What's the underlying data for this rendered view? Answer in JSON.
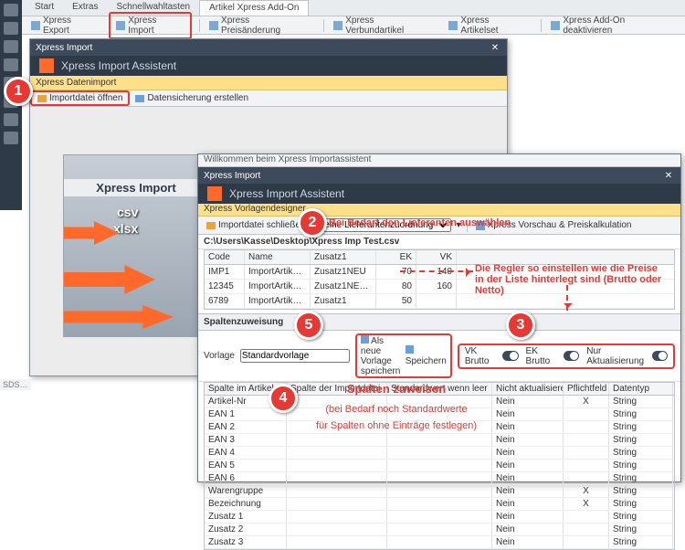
{
  "top_tabs": {
    "start": "Start",
    "extras": "Extras",
    "schnell": "Schnellwahltasten",
    "addon": "Artikel Xpress Add-On"
  },
  "ribbon": {
    "export": "Xpress Export",
    "import": "Xpress Import",
    "preis": "Xpress Preisänderung",
    "verbund": "Xpress Verbundartikel",
    "artikelset": "Xpress Artikelset",
    "deakt": "Xpress Add-On deaktivieren"
  },
  "win1": {
    "title": "Xpress Import",
    "assistent": "Xpress Import Assistent",
    "sub": "Xpress Datenimport",
    "open": "Importdatei öffnen",
    "backup": "Datensicherung erstellen"
  },
  "illus": {
    "title": "Xpress Import",
    "csv": "csv",
    "xlsx": "xlsx"
  },
  "win2": {
    "welcome": "Willkommen beim Xpress Importassistent",
    "title": "Xpress Import",
    "assistent": "Xpress Import Assistent",
    "sub": "Xpress Vorlagendesigner",
    "close_file": "Importdatei schließen",
    "supplier_sel": "Keine Lieferantenzuordnung",
    "preview": "Xpress Vorschau & Preiskalkulation",
    "path": "C:\\Users\\Kasse\\Desktop\\Xpress Imp Test.csv"
  },
  "grid1": {
    "headers": {
      "code": "Code",
      "name": "Name",
      "z1": "Zusatz1",
      "ek": "EK",
      "vk": "VK"
    },
    "rows": [
      {
        "code": "IMP1",
        "name": "ImportArtik…",
        "z1": "Zusatz1NEU",
        "ek": "70",
        "vk": "140"
      },
      {
        "code": "12345",
        "name": "ImportArtik…",
        "z1": "Zusatz1NE…",
        "ek": "80",
        "vk": "160"
      },
      {
        "code": "6789",
        "name": "ImportArtik…",
        "z1": "Zusatz1",
        "ek": "50",
        "vk": ""
      }
    ]
  },
  "spalten": {
    "title": "Spaltenzuweisung",
    "vorlage_lbl": "Vorlage",
    "vorlage_val": "Standardvorlage",
    "save_new": "Als neue Vorlage speichern",
    "save": "Speichern",
    "vk_brutto": "VK Brutto",
    "ek_brutto": "EK Brutto",
    "nur_akt": "Nur Aktualisierung",
    "h1": "Spalte im Artikelstamm",
    "h2": "Spalte der Importdatei",
    "h3": "Standardwert wenn leer",
    "h4": "Nicht aktualisieren",
    "h5": "Pflichtfeld",
    "h6": "Datentyp",
    "rows": [
      {
        "c1": "Artikel-Nr",
        "c4": "Nein",
        "c5": "X",
        "c6": "String"
      },
      {
        "c1": "EAN 1",
        "c4": "Nein",
        "c5": "",
        "c6": "String"
      },
      {
        "c1": "EAN 2",
        "c4": "Nein",
        "c5": "",
        "c6": "String"
      },
      {
        "c1": "EAN 3",
        "c4": "Nein",
        "c5": "",
        "c6": "String"
      },
      {
        "c1": "EAN 4",
        "c4": "Nein",
        "c5": "",
        "c6": "String"
      },
      {
        "c1": "EAN 5",
        "c4": "Nein",
        "c5": "",
        "c6": "String"
      },
      {
        "c1": "EAN 6",
        "c4": "Nein",
        "c5": "",
        "c6": "String"
      },
      {
        "c1": "Warengruppe",
        "c4": "Nein",
        "c5": "X",
        "c6": "String"
      },
      {
        "c1": "Bezeichnung",
        "c4": "Nein",
        "c5": "X",
        "c6": "String"
      },
      {
        "c1": "Zusatz 1",
        "c4": "Nein",
        "c5": "",
        "c6": "String"
      },
      {
        "c1": "Zusatz 2",
        "c4": "Nein",
        "c5": "",
        "c6": "String"
      },
      {
        "c1": "Zusatz 3",
        "c4": "Nein",
        "c5": "",
        "c6": "String"
      }
    ]
  },
  "ann": {
    "supplier": "Bei Bedarf den Lieferanten auswählen",
    "toggles_l1": "Die Regler so einstellen wie die Preise",
    "toggles_l2": "in der Liste hinterlegt sind (Brutto oder Netto)",
    "cols_title": "Spalten zuweisen",
    "cols_l1": "(bei Bedarf noch Standardwerte",
    "cols_l2": "für Spalten ohne Einträge festlegen)"
  },
  "callouts": {
    "c1": "1",
    "c2": "2",
    "c3": "3",
    "c4": "4",
    "c5": "5"
  },
  "sds": "SDS…"
}
